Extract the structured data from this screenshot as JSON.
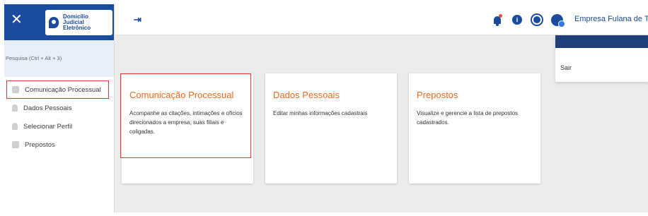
{
  "sidebar": {
    "close_label": "✕",
    "logo_lines": [
      "Domicílio",
      "Judicial",
      "Eletrônico"
    ],
    "search_placeholder": "Pesquisa (Ctrl + Alt + 3)",
    "items": [
      {
        "label": "Comunicação Processual",
        "icon": "envelope-icon",
        "active": true
      },
      {
        "label": "Dados Pessoais",
        "icon": "person-icon",
        "active": false
      },
      {
        "label": "Selecionar Perfil",
        "icon": "person-icon",
        "active": false
      },
      {
        "label": "Prepostos",
        "icon": "group-icon",
        "active": false
      }
    ]
  },
  "header": {
    "pin_label": "⇥",
    "company": "Empresa Fulana de Tal",
    "notification_dot_color": "#e84c3d",
    "info_label": "i"
  },
  "dropdown": {
    "sair_label": "Sair"
  },
  "cards": [
    {
      "title": "Comunicação Processual",
      "description": "Acompanhe as citações, intimações e ofícios direcionados a empresa, suas filiais e coligadas."
    },
    {
      "title": "Dados Pessoais",
      "description": "Editar minhas informações cadastrais"
    },
    {
      "title": "Prepostos",
      "description": "Visualize e gerencie a lista de prepostos cadastrados."
    }
  ],
  "colors": {
    "brand": "#1b4b9e",
    "accent": "#f26a1e",
    "highlight": "#e53935"
  }
}
